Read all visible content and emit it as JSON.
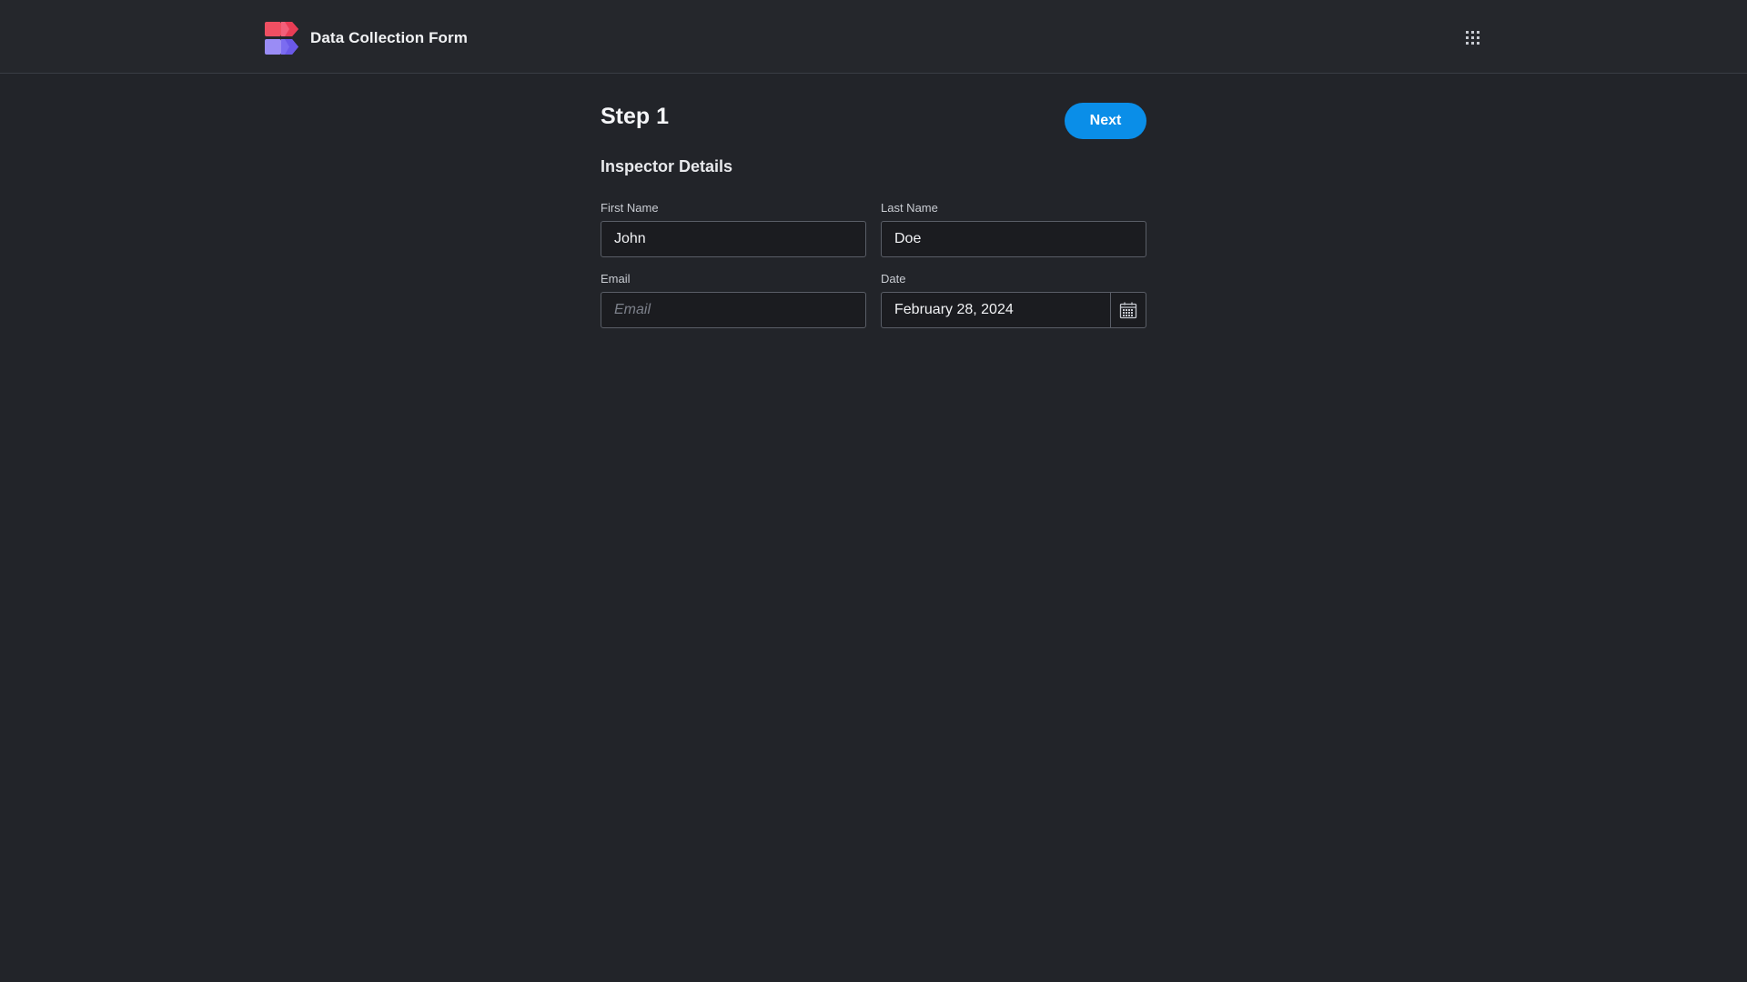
{
  "header": {
    "app_title": "Data Collection Form",
    "logo_icon": "app-logo",
    "apps_icon": "grid-menu-icon"
  },
  "form": {
    "step_title": "Step 1",
    "next_label": "Next",
    "section_title": "Inspector Details",
    "fields": {
      "first_name": {
        "label": "First Name",
        "value": "John",
        "placeholder": ""
      },
      "last_name": {
        "label": "Last Name",
        "value": "Doe",
        "placeholder": ""
      },
      "email": {
        "label": "Email",
        "value": "",
        "placeholder": "Email"
      },
      "date": {
        "label": "Date",
        "value": "February 28, 2024",
        "icon": "calendar-icon"
      }
    }
  },
  "colors": {
    "background": "#222429",
    "topbar": "#25272c",
    "accent": "#0a8ee8",
    "logo_red": "#ef4f62",
    "logo_purple": "#7b6cf0"
  }
}
